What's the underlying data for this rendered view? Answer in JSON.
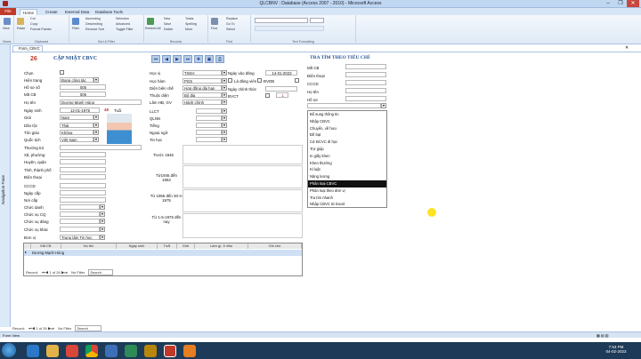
{
  "window": {
    "title": "QLCBNV : Database (Access 2007 - 2010) - Microsoft Access",
    "min": "–",
    "max": "❐",
    "close": "✕"
  },
  "ribbon_tabs": [
    "File",
    "Home",
    "Create",
    "External Data",
    "Database Tools"
  ],
  "ribbon": {
    "views": {
      "label": "View",
      "group": "Views"
    },
    "clipboard": {
      "paste": "Paste",
      "cut": "Cut",
      "copy": "Copy",
      "painter": "Format Painter",
      "group": "Clipboard"
    },
    "sort": {
      "filter": "Filter",
      "asc": "Ascending",
      "desc": "Descending",
      "remove": "Remove Sort",
      "sel": "Selection",
      "adv": "Advanced",
      "toggle": "Toggle Filter",
      "group": "Sort & Filter"
    },
    "records": {
      "refresh": "Refresh All",
      "new": "New",
      "save": "Save",
      "delete": "Delete",
      "totals": "Totals",
      "spelling": "Spelling",
      "more": "More",
      "group": "Records"
    },
    "find": {
      "find": "Find",
      "replace": "Replace",
      "goto": "Go To",
      "select": "Select",
      "group": "Find"
    },
    "text": {
      "group": "Text Formatting"
    }
  },
  "nav_pane": "Navigation Pane",
  "doc_tab": "Form_CBVC",
  "form": {
    "id": "26",
    "title": "CẬP NHẬT CBVC",
    "left_labels": [
      "Chọn",
      "Hiện trạng",
      "Hồ sơ số",
      "Mã CB",
      "Họ tên",
      "Ngày sinh",
      "Giới",
      "Dân tộc",
      "Tôn giáo",
      "Quốc tịch",
      "Thường trú",
      "Xã, phường",
      "Huyện, quận",
      "Tỉnh, thành phố",
      "Điện thoại",
      "CCCD",
      "Ngày cấp",
      "Nơi cấp",
      "Chức danh",
      "Chức vụ CQ",
      "Chức vụ đảng",
      "Chức vụ khác",
      "Đơn vị"
    ],
    "hien_trang": "Đang công tác",
    "ho_so_so": "005",
    "ma_cb": "005",
    "ho_ten": "Dương Mạnh Hùng",
    "ngay_sinh": "12-01-1975",
    "tuoi": "48",
    "tuoi_label": "Tuổi",
    "gioi": "Nam",
    "dan_toc": "Thái",
    "ton_giao": "Không",
    "quoc_tich": "Việt Nam",
    "don_vi": "Trung tâm Tin học",
    "mid_labels": [
      "Học vị",
      "Học hàm",
      "Diện biên chế",
      "Thuộc diện",
      "Lâm HĐ, GV",
      "LLCT",
      "QLNN",
      "Tiếng",
      "Ngoại ngữ",
      "Tin học"
    ],
    "hoc_vi": "TSKH",
    "hoc_ham": "PGS",
    "dien_bien_che": "Hợp đồng dài hạn",
    "thuoc_dien": "Bộ địa",
    "lam_hd": "Hành chính",
    "periods": [
      "Trước 1945",
      "Từ1945 đến 1954",
      "Từ 1955 đến 30-4-1975",
      "Từ 1-5-1975 đến nay"
    ],
    "right_labels": [
      "Ngày vào đảng",
      "Là đảng viên",
      "Ngày chính thức",
      "ĐVCT"
    ],
    "ngay_vao_dang": "14-01-2023",
    "dvdb": "ĐVDB",
    "dvct_count": "1"
  },
  "search": {
    "title": "TRA TÌM THEO TIÊU CHÍ",
    "fields": [
      "Mã CB",
      "Điện thoại",
      "CCCD",
      "Họ tên",
      "Hồ sơ"
    ]
  },
  "menu": {
    "items": [
      "Bổ sung thông tin",
      "Nhập CBVC",
      "Chuyển, về hưu",
      "Đề bạt",
      "Cử ĐCVC đi học",
      "Trợ giúp",
      "In giấy khen",
      "Khen thưởng",
      "Kỉ luật",
      "Nâng lương",
      "Phân loại CBVC",
      "Phân loại theo đơn vị",
      "Tra tìm nhanh",
      "Nhập CBVC từ Excel"
    ],
    "selected": 10
  },
  "grid": {
    "headers": [
      "Mã CB",
      "Họ tên",
      "Ngày sinh",
      "Tuổi",
      "Giới",
      "Làm gì, ở đâu",
      "Ghi chú"
    ],
    "row": [
      "",
      "Dương Mạnh Hùng",
      "",
      "",
      "",
      "",
      ""
    ]
  },
  "inner_nav": {
    "record": "Record:",
    "pos": "1 of 26",
    "filter": "No Filter",
    "search": "Search"
  },
  "outer_nav": {
    "record": "Record:",
    "pos": "1 of 26",
    "filter": "No Filter",
    "search": "Search"
  },
  "status": {
    "left": "Form View"
  },
  "taskbar": {
    "time": "7:53 PM",
    "date": "04-02-2023"
  }
}
